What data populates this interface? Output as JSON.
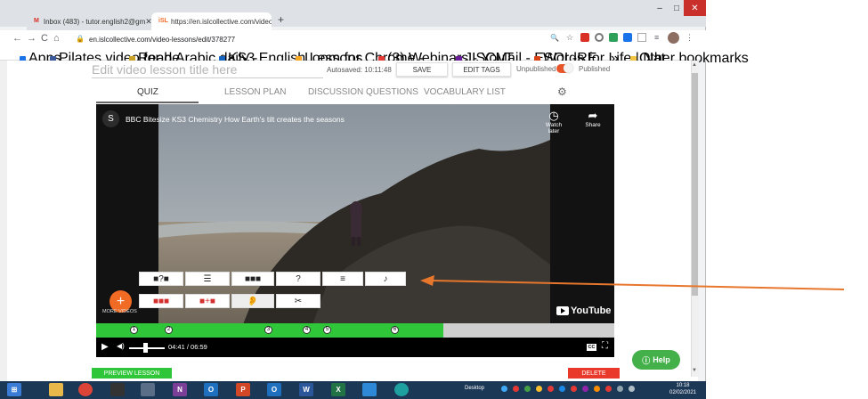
{
  "browser": {
    "tabs": [
      {
        "label": "Inbox (483) - tutor.english2@gm",
        "active": false
      },
      {
        "label": "https://en.islcollective.com/video",
        "active": true
      }
    ],
    "new_tab": "+",
    "window_controls": {
      "minimize": "–",
      "maximize": "□",
      "close": "✕"
    },
    "url": "en.islcollective.com/video-lessons/edit/378277",
    "bookmarks": [
      "Apps",
      "Pilates video for be...",
      "Read Arabic daily -...",
      "KS3 English Lessons...",
      "Loom for Chrome -...",
      "(3) Webinars - YouT...",
      "JISCMail - ESOL-RE...",
      "Words for Life | Nat...",
      "»",
      "Other bookmarks"
    ]
  },
  "editor": {
    "title_placeholder": "Edit video lesson title here",
    "autosaved": "Autosaved: 10:11:48",
    "save_label": "SAVE",
    "edit_tags_label": "EDIT TAGS",
    "unpublished_label": "Unpublished",
    "published_label": "Published",
    "tabs": [
      {
        "label": "QUIZ",
        "active": true
      },
      {
        "label": "LESSON PLAN",
        "active": false
      },
      {
        "label": "DISCUSSION QUESTIONS",
        "active": false
      },
      {
        "label": "VOCABULARY LIST",
        "active": false
      }
    ],
    "preview_label": "PREVIEW LESSON",
    "delete_label": "DELETE",
    "help_label": "Help"
  },
  "video": {
    "channel_initial": "S",
    "title": "BBC Bitesize KS3 Chemistry How Earth's tilt creates the seasons",
    "watch_later": "Watch later",
    "share": "Share",
    "more_videos": "MORE VIDEOS",
    "youtube_logo": "YouTube",
    "timecode": "04:41 / 06:59",
    "progress_fraction": 0.67,
    "marker_labels": [
      "1",
      "2",
      "3",
      "4",
      "5",
      "6"
    ],
    "cc_label": "CC",
    "quiz_buttons_row1": [
      "■?■",
      "☰",
      "■■■",
      "?",
      "≡",
      "♪"
    ],
    "quiz_buttons_row2": [
      "■■■",
      "■+■",
      "👂",
      "✂"
    ]
  },
  "taskbar": {
    "desktop_label": "Desktop",
    "time": "10:18",
    "date": "02/02/2021"
  },
  "colors": {
    "accent_green": "#2fc63a",
    "accent_orange": "#f26b24",
    "delete_red": "#e8392a",
    "arrow_orange": "#e8772e"
  }
}
